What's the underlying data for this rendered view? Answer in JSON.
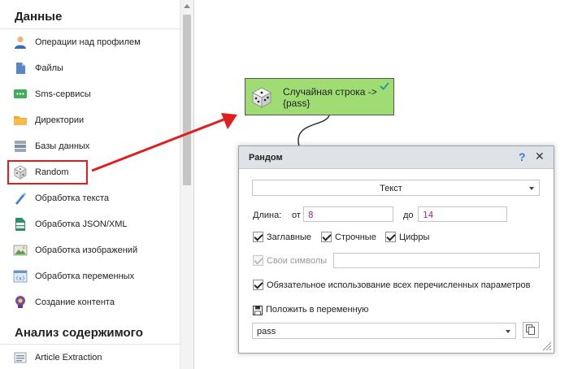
{
  "sidebar": {
    "section1_title": "Данные",
    "section2_title": "Анализ содержимого",
    "items": [
      {
        "label": "Операции над профилем",
        "icon": "profile-icon"
      },
      {
        "label": "Файлы",
        "icon": "file-icon"
      },
      {
        "label": "Sms-сервисы",
        "icon": "sms-icon"
      },
      {
        "label": "Директории",
        "icon": "folder-icon"
      },
      {
        "label": "Базы данных",
        "icon": "database-icon"
      },
      {
        "label": "Random",
        "icon": "dice-icon"
      },
      {
        "label": "Обработка текста",
        "icon": "text-tool-icon"
      },
      {
        "label": "Обработка JSON/XML",
        "icon": "json-icon"
      },
      {
        "label": "Обработка изображений",
        "icon": "image-icon"
      },
      {
        "label": "Обработка переменных",
        "icon": "variable-icon"
      },
      {
        "label": "Создание контента",
        "icon": "content-icon"
      }
    ],
    "analysis_items": [
      {
        "label": "Article Extraction",
        "icon": "article-icon"
      }
    ]
  },
  "node": {
    "title_line1": "Случайная строка ->",
    "title_line2": "{pass}",
    "icon": "dice-icon",
    "status_icon": "check-icon"
  },
  "dialog": {
    "title": "Рандом",
    "help": "?",
    "close": "✕",
    "type_value": "Текст",
    "length_label": "Длина:",
    "from_label": "от",
    "from_value": "8",
    "to_label": "до",
    "to_value": "14",
    "uppercase_label": "Заглавные",
    "lowercase_label": "Строчные",
    "digits_label": "Цифры",
    "custom_label": "Свои символы",
    "custom_value": "",
    "mandatory_label": "Обязательное использование всех перечисленных параметров",
    "save_label": "Положить в переменную",
    "variable_value": "pass"
  },
  "colors": {
    "node_fill": "#9fdc74",
    "arrow": "#e01e1e",
    "highlight": "#e01e1e",
    "help": "#3a7bd5",
    "mono_value": "#a0307a"
  }
}
